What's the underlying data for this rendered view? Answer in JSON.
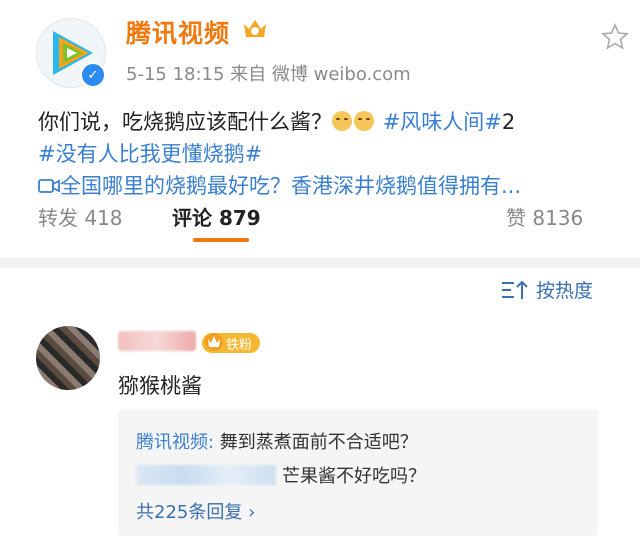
{
  "post": {
    "account_name": "腾讯视频",
    "meta": "5-15 18:15  来自 微博 weibo.com",
    "text_line1": "你们说，吃烧鹅应该配什么酱？",
    "hashtag1": "#风味人间#",
    "hashtag1_suffix": "2",
    "hashtag2": "#没有人比我更懂烧鹅#",
    "video_link": "全国哪里的烧鹅最好吃？香港深井烧鹅值得拥有..."
  },
  "stats": {
    "repost": "转发 418",
    "comments": "评论 879",
    "likes": "赞 8136"
  },
  "sort": {
    "label": "按热度"
  },
  "comment": {
    "fan_badge": "铁粉",
    "text": "猕猴桃酱",
    "reply1_author": "腾讯视频:",
    "reply1_text": " 舞到蒸煮面前不合适吧？",
    "reply2_text": "芒果酱不好吃吗？",
    "view_replies": "共225条回复 ›"
  },
  "colors": {
    "accent": "#f07a10",
    "link": "#3a7fd0",
    "verified": "#2a8cf0"
  },
  "icons": [
    "tencent-video-logo",
    "verified-icon",
    "vip-crown-icon",
    "star-icon",
    "sort-icon",
    "video-icon"
  ]
}
